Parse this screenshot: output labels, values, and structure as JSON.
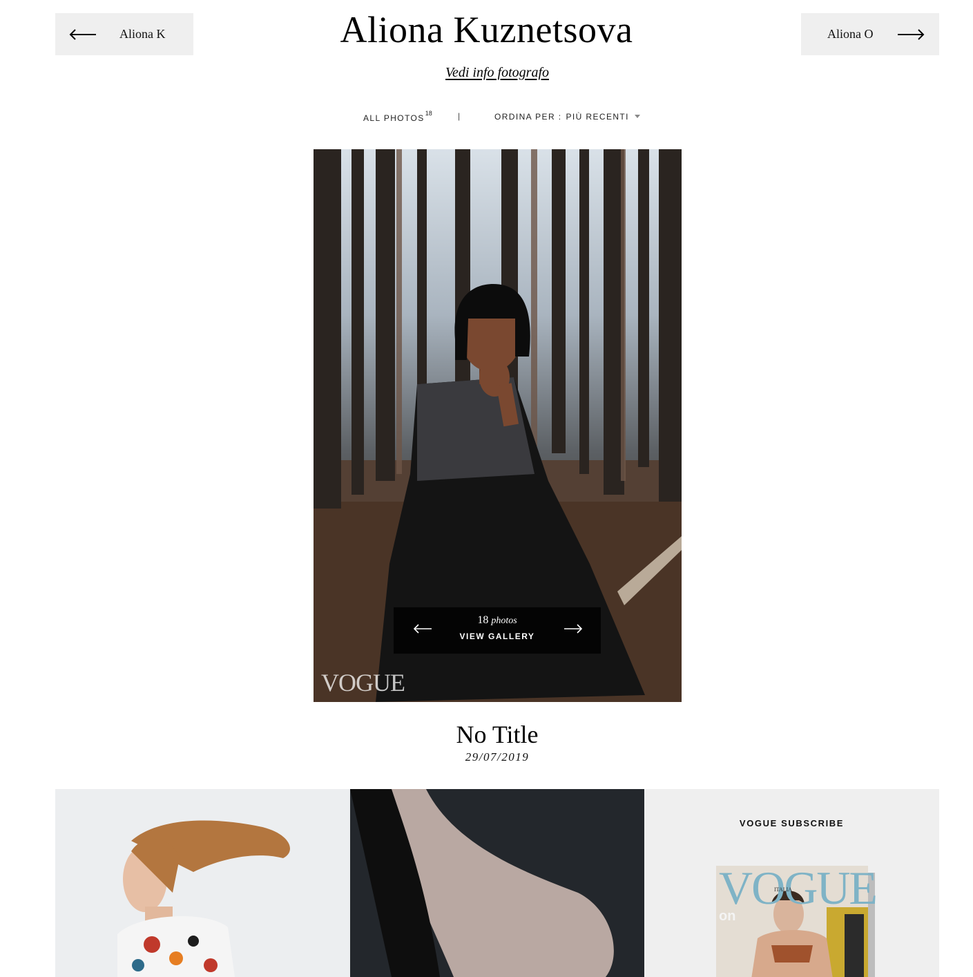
{
  "header": {
    "prev_label": "Aliona K",
    "next_label": "Aliona O",
    "photographer_name": "Aliona Kuznetsova",
    "info_link": "Vedi info fotografo"
  },
  "filter": {
    "all_photos_label": "ALL PHOTOS",
    "all_photos_count": "18",
    "separator": "|",
    "sort_label": "ORDINA PER :",
    "sort_value": "PIÙ RECENTI"
  },
  "hero": {
    "count_number": "18",
    "count_word": "photos",
    "view_gallery": "VIEW GALLERY",
    "watermark": "VOGUE"
  },
  "caption": {
    "title": "No Title",
    "date": "29/07/2019"
  },
  "sidebar_promo": {
    "title": "VOGUE SUBSCRIBE",
    "cover_masthead": "VOGUE",
    "cover_subtitle": "ITALIA",
    "cover_tag": "on"
  },
  "icons": {
    "prev": "arrow-left-icon",
    "next": "arrow-right-icon",
    "sort": "caret-down-icon"
  },
  "colors": {
    "nav_button_bg": "#efefef",
    "overlay_bg": "#000000",
    "cover_masthead": "#7fb3c6"
  }
}
